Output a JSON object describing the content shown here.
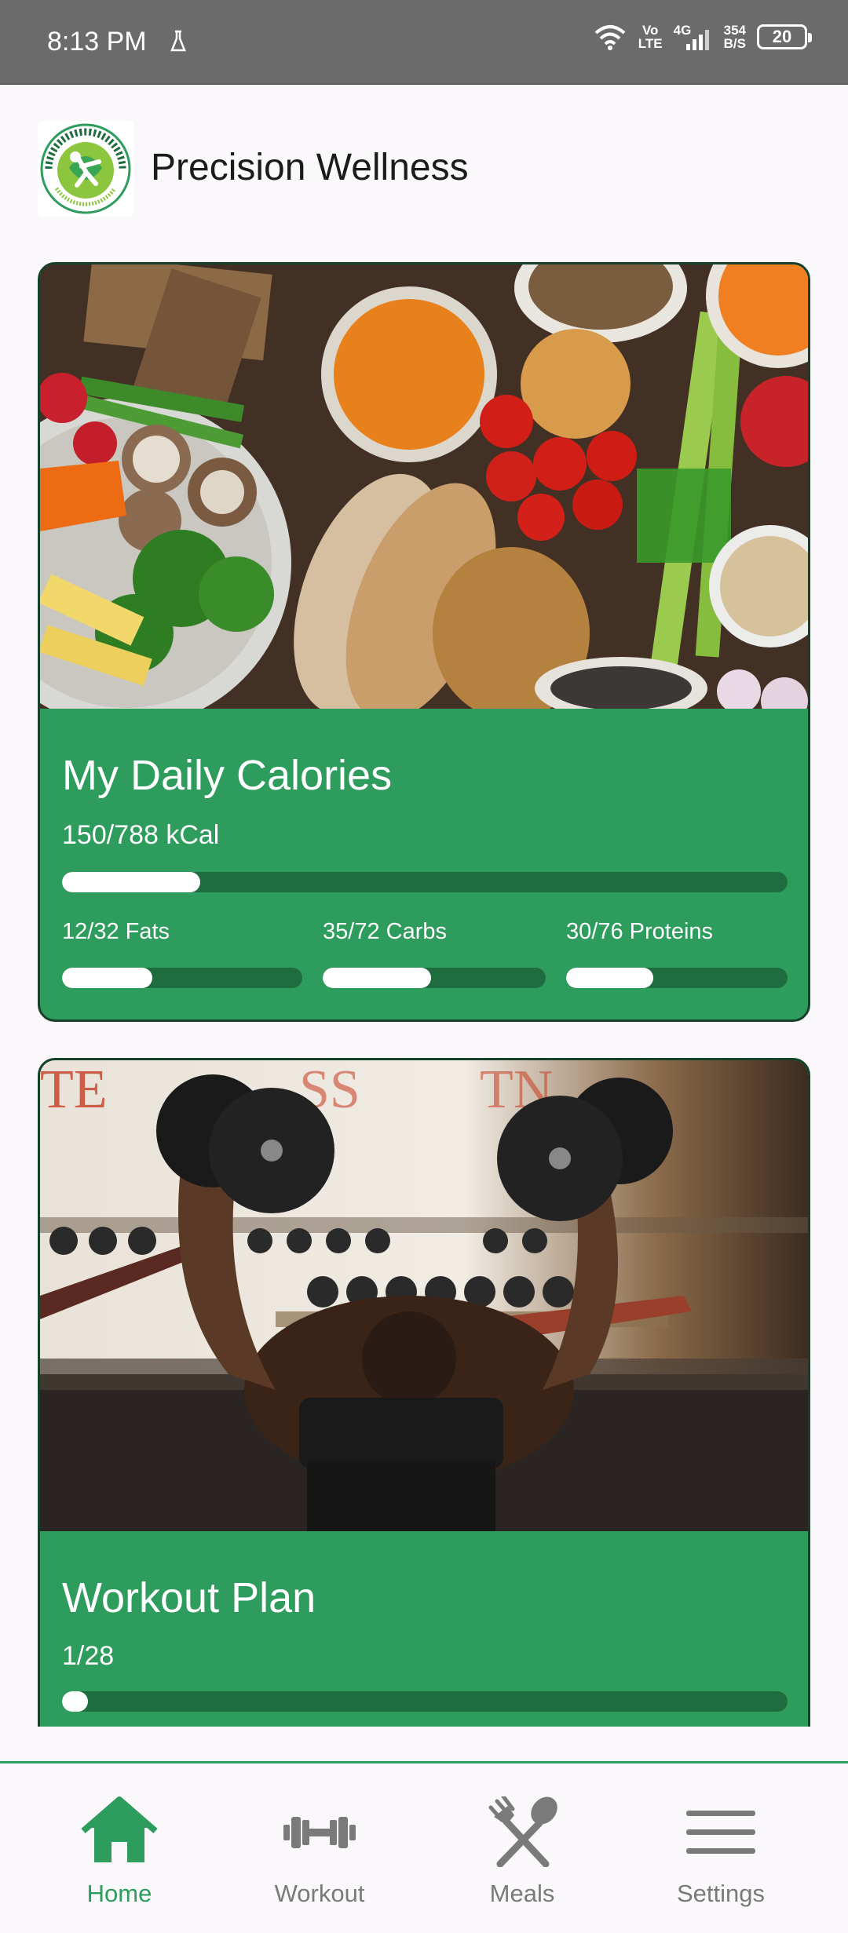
{
  "status_bar": {
    "time": "8:13 PM",
    "network_top": "Vo",
    "network_bottom": "LTE",
    "signal_label": "4G",
    "speed_value": "354",
    "speed_unit": "B/S",
    "battery": "20"
  },
  "app": {
    "title": "Precision Wellness"
  },
  "calories_card": {
    "title": "My Daily Calories",
    "summary": "150/788 kCal",
    "summary_progress": 0.19,
    "macros": [
      {
        "label": "12/32 Fats",
        "progress": 0.375
      },
      {
        "label": "35/72 Carbs",
        "progress": 0.486
      },
      {
        "label": "30/76 Proteins",
        "progress": 0.395
      }
    ]
  },
  "workout_card": {
    "title": "Workout Plan",
    "summary": "1/28",
    "progress": 0.036
  },
  "bottom_nav": [
    {
      "label": "Home",
      "icon": "home-icon",
      "active": true
    },
    {
      "label": "Workout",
      "icon": "dumbbell-icon",
      "active": false
    },
    {
      "label": "Meals",
      "icon": "fork-spoon-icon",
      "active": false
    },
    {
      "label": "Settings",
      "icon": "menu-icon",
      "active": false
    }
  ],
  "colors": {
    "accent": "#2e9c5c",
    "track": "#1f6c3e",
    "status_bar": "#6b6b6b"
  }
}
